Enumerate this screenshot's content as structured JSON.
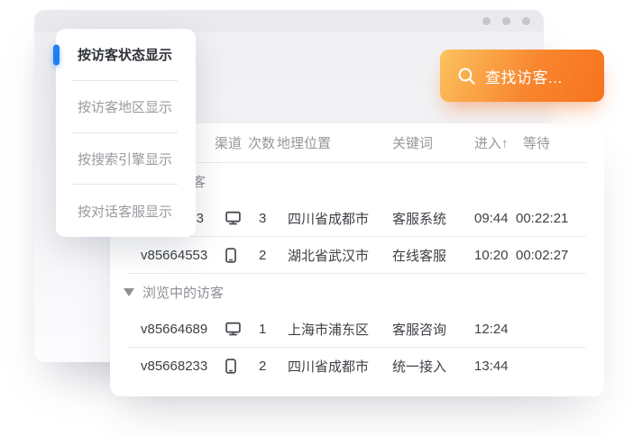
{
  "colors": {
    "accent_blue": "#1e80f0",
    "orange_start": "#fcc35f",
    "orange_end": "#f7731d",
    "menu_active_text": "#2f3237",
    "menu_text": "#9a9aa0",
    "table_text": "#3d4045",
    "muted_text": "#97979c",
    "divider": "#ebebee"
  },
  "menu": {
    "items": [
      {
        "label": "按访客状态显示",
        "active": true
      },
      {
        "label": "按访客地区显示",
        "active": false
      },
      {
        "label": "按搜索引擎显示",
        "active": false
      },
      {
        "label": "按对话客服显示",
        "active": false
      }
    ]
  },
  "search_button": {
    "label": "查找访客..."
  },
  "table": {
    "headers": {
      "channel": "渠道",
      "count": "次数",
      "location": "地理位置",
      "keyword": "关键词",
      "enter": "进入↑",
      "wait": "等待"
    },
    "sections": [
      {
        "title": "对话中的访客",
        "rows": [
          {
            "id": "3",
            "device": "desktop",
            "count": "3",
            "location": "四川省成都市",
            "keyword": "客服系统",
            "enter": "09:44",
            "wait": "00:22:21"
          },
          {
            "id": "v85664553",
            "device": "mobile",
            "count": "2",
            "location": "湖北省武汉市",
            "keyword": "在线客服",
            "enter": "10:20",
            "wait": "00:02:27"
          }
        ]
      },
      {
        "title": "浏览中的访客",
        "rows": [
          {
            "id": "v85664689",
            "device": "desktop",
            "count": "1",
            "location": "上海市浦东区",
            "keyword": "客服咨询",
            "enter": "12:24",
            "wait": ""
          },
          {
            "id": "v85668233",
            "device": "mobile",
            "count": "2",
            "location": "四川省成都市",
            "keyword": "统一接入",
            "enter": "13:44",
            "wait": ""
          }
        ]
      }
    ]
  }
}
